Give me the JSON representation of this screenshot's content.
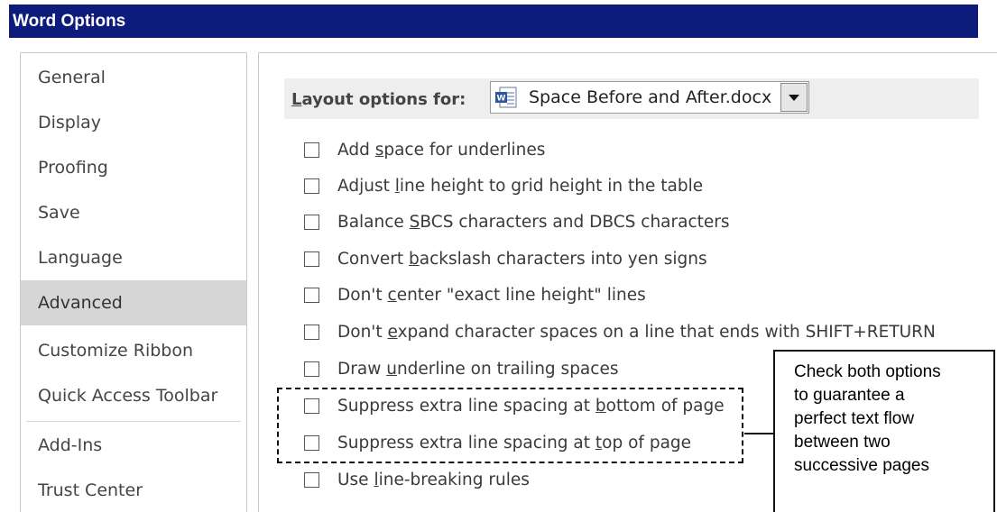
{
  "window": {
    "title": "Word Options"
  },
  "sidebar": {
    "items": [
      {
        "label": "General"
      },
      {
        "label": "Display"
      },
      {
        "label": "Proofing"
      },
      {
        "label": "Save"
      },
      {
        "label": "Language"
      },
      {
        "label": "Advanced",
        "active": true
      },
      {
        "label": "Customize Ribbon"
      },
      {
        "label": "Quick Access Toolbar"
      },
      {
        "label": "Add-Ins"
      },
      {
        "label": "Trust Center"
      }
    ]
  },
  "layout": {
    "label_pre": "",
    "label_u": "L",
    "label_post": "ayout options for:",
    "document": "Space Before and After.docx",
    "document_icon": "word-document-icon"
  },
  "options": [
    {
      "pre": "Add ",
      "u": "s",
      "post": "pace for underlines",
      "checked": false
    },
    {
      "pre": "Adjust ",
      "u": "l",
      "post": "ine height to grid height in the table",
      "checked": false
    },
    {
      "pre": "Balance ",
      "u": "S",
      "post": "BCS characters and DBCS characters",
      "checked": false
    },
    {
      "pre": "Convert ",
      "u": "b",
      "post": "ackslash characters into yen signs",
      "checked": false
    },
    {
      "pre": "Don't ",
      "u": "c",
      "post": "enter \"exact line height\" lines",
      "checked": false
    },
    {
      "pre": "Don't ",
      "u": "e",
      "post": "xpand character spaces on a line that ends with SHIFT+RETURN",
      "checked": false
    },
    {
      "pre": "Draw ",
      "u": "u",
      "post": "nderline on trailing spaces",
      "checked": false
    },
    {
      "pre": "Suppress extra line spacing at ",
      "u": "b",
      "post": "ottom of page",
      "checked": false
    },
    {
      "pre": "Suppress extra line spacing at ",
      "u": "t",
      "post": "op of page",
      "checked": false
    },
    {
      "pre": "Use ",
      "u": "l",
      "post": "ine-breaking rules",
      "checked": false
    }
  ],
  "callout": {
    "lines": [
      "Check both options",
      "to guarantee a",
      "perfect text flow",
      "between two",
      "successive pages"
    ]
  },
  "colors": {
    "titlebar": "#0d1b7a",
    "active_nav": "#d6d6d6"
  }
}
